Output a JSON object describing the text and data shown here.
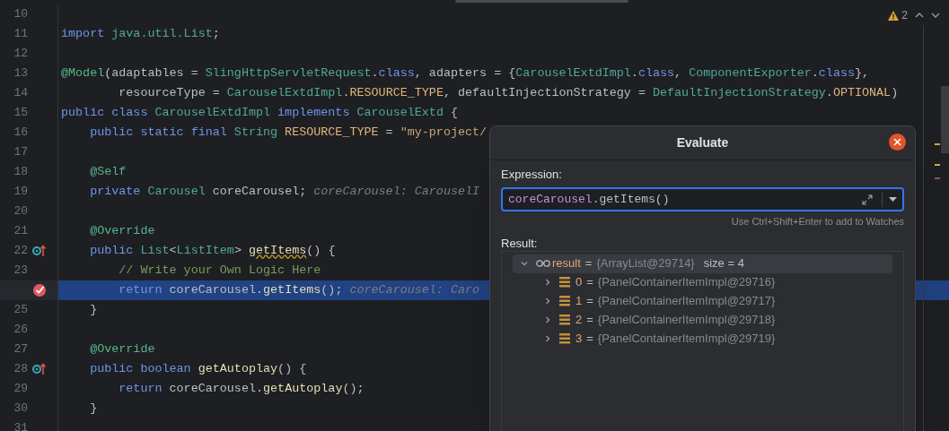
{
  "editor": {
    "warnings": {
      "count": "2"
    },
    "lines": [
      {
        "number": "10"
      },
      {
        "number": "11",
        "tokens": [
          {
            "text": "import ",
            "kind": "keyword"
          },
          {
            "text": "java.util.",
            "kind": "type"
          },
          {
            "text": "List",
            "kind": "type"
          },
          {
            "text": ";",
            "kind": "plain"
          }
        ]
      },
      {
        "number": "12"
      },
      {
        "number": "13",
        "tokens": [
          {
            "text": "@Model",
            "kind": "annotation"
          },
          {
            "text": "(adaptables = ",
            "kind": "plain"
          },
          {
            "text": "SlingHttpServletRequest",
            "kind": "type"
          },
          {
            "text": ".",
            "kind": "plain"
          },
          {
            "text": "class",
            "kind": "keyword"
          },
          {
            "text": ", adapters = {",
            "kind": "plain"
          },
          {
            "text": "CarouselExtdImpl",
            "kind": "type"
          },
          {
            "text": ".",
            "kind": "plain"
          },
          {
            "text": "class",
            "kind": "keyword"
          },
          {
            "text": ", ",
            "kind": "plain"
          },
          {
            "text": "ComponentExporter",
            "kind": "type"
          },
          {
            "text": ".",
            "kind": "plain"
          },
          {
            "text": "class",
            "kind": "keyword"
          },
          {
            "text": "},",
            "kind": "plain"
          }
        ]
      },
      {
        "number": "14",
        "tokens": [
          {
            "text": "        resourceType = ",
            "kind": "plain"
          },
          {
            "text": "CarouselExtdImpl",
            "kind": "type"
          },
          {
            "text": ".",
            "kind": "plain"
          },
          {
            "text": "RESOURCE_TYPE",
            "kind": "constant"
          },
          {
            "text": ", defaultInjectionStrategy = ",
            "kind": "plain"
          },
          {
            "text": "DefaultInjectionStrategy",
            "kind": "type"
          },
          {
            "text": ".",
            "kind": "plain"
          },
          {
            "text": "OPTIONAL",
            "kind": "constant"
          },
          {
            "text": ")",
            "kind": "plain"
          }
        ]
      },
      {
        "number": "15",
        "tokens": [
          {
            "text": "public class ",
            "kind": "keyword"
          },
          {
            "text": "CarouselExtdImpl",
            "kind": "type"
          },
          {
            "text": " implements ",
            "kind": "keyword"
          },
          {
            "text": "CarouselExtd",
            "kind": "type"
          },
          {
            "text": " {",
            "kind": "plain"
          }
        ]
      },
      {
        "number": "16",
        "tokens": [
          {
            "text": "    public static final ",
            "kind": "keyword"
          },
          {
            "text": "String",
            "kind": "type"
          },
          {
            "text": " RESOURCE_TYPE",
            "kind": "constant"
          },
          {
            "text": " = ",
            "kind": "plain"
          },
          {
            "text": "\"my-project/",
            "kind": "string"
          }
        ]
      },
      {
        "number": "17"
      },
      {
        "number": "18",
        "tokens": [
          {
            "text": "    @Self",
            "kind": "annotation"
          }
        ]
      },
      {
        "number": "19",
        "tokens": [
          {
            "text": "    private ",
            "kind": "keyword"
          },
          {
            "text": "Carousel",
            "kind": "type"
          },
          {
            "text": " coreCarousel;",
            "kind": "plain"
          },
          {
            "text": "coreCarousel: CarouselI",
            "kind": "hint"
          }
        ]
      },
      {
        "number": "20"
      },
      {
        "number": "21",
        "tokens": [
          {
            "text": "    @Override",
            "kind": "annotation"
          }
        ]
      },
      {
        "number": "22",
        "gutter": {
          "kind": "override"
        },
        "tokens": [
          {
            "text": "    public ",
            "kind": "keyword"
          },
          {
            "text": "List",
            "kind": "type"
          },
          {
            "text": "<",
            "kind": "plain"
          },
          {
            "text": "ListItem",
            "kind": "type"
          },
          {
            "text": "> ",
            "kind": "plain"
          },
          {
            "text": "getItems",
            "kind": "warning"
          },
          {
            "text": "() {",
            "kind": "plain"
          }
        ]
      },
      {
        "number": "23",
        "tokens": [
          {
            "text": "        // Write your Own Logic Here",
            "kind": "comment"
          }
        ]
      },
      {
        "gutter": {
          "kind": "breakpoint"
        },
        "highlighted": true,
        "tokens": [
          {
            "text": "        return ",
            "kind": "keyword"
          },
          {
            "text": "coreCarousel",
            "kind": "plain"
          },
          {
            "text": ".",
            "kind": "plain"
          },
          {
            "text": "getItems",
            "kind": "method"
          },
          {
            "text": "();",
            "kind": "plain"
          },
          {
            "text": "coreCarousel: Caro",
            "kind": "hint"
          }
        ]
      },
      {
        "number": "25",
        "tokens": [
          {
            "text": "    }",
            "kind": "plain"
          }
        ]
      },
      {
        "number": "26"
      },
      {
        "number": "27",
        "tokens": [
          {
            "text": "    @Override",
            "kind": "annotation"
          }
        ]
      },
      {
        "number": "28",
        "gutter": {
          "kind": "override"
        },
        "tokens": [
          {
            "text": "    public boolean ",
            "kind": "keyword"
          },
          {
            "text": "getAutoplay",
            "kind": "method"
          },
          {
            "text": "() {",
            "kind": "plain"
          }
        ]
      },
      {
        "number": "29",
        "tokens": [
          {
            "text": "        return ",
            "kind": "keyword"
          },
          {
            "text": "coreCarousel",
            "kind": "plain"
          },
          {
            "text": ".",
            "kind": "plain"
          },
          {
            "text": "getAutoplay",
            "kind": "method"
          },
          {
            "text": "();",
            "kind": "plain"
          }
        ]
      },
      {
        "number": "30",
        "tokens": [
          {
            "text": "    }",
            "kind": "plain"
          }
        ]
      },
      {
        "number": "31"
      }
    ]
  },
  "dialog": {
    "title": "Evaluate",
    "expression_label": "Expression:",
    "expression": [
      {
        "text": "coreCarousel",
        "kind": "field"
      },
      {
        "text": ".getItems()",
        "kind": "plain"
      }
    ],
    "hint": "Use Ctrl+Shift+Enter to add to Watches",
    "result_label": "Result:",
    "result": {
      "name": "result",
      "separator": "=",
      "value": "{ArrayList@29714}",
      "extra": "size = 4",
      "expanded": true,
      "selected": true,
      "children": [
        {
          "name": "0",
          "separator": "=",
          "value": "{PanelContainerItemImpl@29716}",
          "expanded": false,
          "selected": false
        },
        {
          "name": "1",
          "separator": "=",
          "value": "{PanelContainerItemImpl@29717}",
          "expanded": false,
          "selected": false
        },
        {
          "name": "2",
          "separator": "=",
          "value": "{PanelContainerItemImpl@29718}",
          "expanded": false,
          "selected": false
        },
        {
          "name": "3",
          "separator": "=",
          "value": "{PanelContainerItemImpl@29719}",
          "expanded": false,
          "selected": false
        }
      ]
    }
  }
}
